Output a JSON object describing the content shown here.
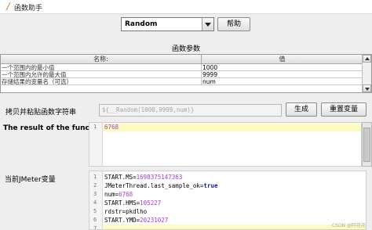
{
  "window": {
    "title": "函数助手"
  },
  "toolbar": {
    "selected_function": "Random",
    "help_label": "帮助"
  },
  "params": {
    "title": "函数参数",
    "columns": [
      "名称:",
      "值"
    ],
    "rows": [
      {
        "name": "一个范围内的最小值",
        "value": "1000"
      },
      {
        "name": "一个范围内允许的最大值",
        "value": "9999"
      },
      {
        "name": "存储结果的变量名（可选）",
        "value": "num"
      }
    ]
  },
  "copy": {
    "label": "拷贝并粘贴函数字符串",
    "function_string": "${__Random(1000,9999,num)}",
    "generate_label": "生成",
    "reset_label": "重置变量"
  },
  "result": {
    "label": "The result of the function is",
    "lines": [
      {
        "no": "1",
        "text": "6768"
      }
    ]
  },
  "variables": {
    "label": "当前JMeter变量",
    "line_numbers": [
      "1",
      "2",
      "3",
      "4",
      "5",
      "6",
      "7"
    ],
    "lines": [
      {
        "key": "START.MS=",
        "value": "1698375147363"
      },
      {
        "key": "JMeterThread.last_sample_ok=",
        "value": "true"
      },
      {
        "key": "num=",
        "value": "6768"
      },
      {
        "key": "START.HMS=",
        "value": "105227"
      },
      {
        "key": "rdstr=pkdlho",
        "value": ""
      },
      {
        "key": "START.YMD=",
        "value": "20231027"
      },
      {
        "key": "",
        "value": ""
      }
    ]
  },
  "watermark": "CSDN @阿花花",
  "colors": {
    "current_line": "#fffbbe",
    "number": "#a03ad8",
    "keyword": "#1a1aa6"
  }
}
